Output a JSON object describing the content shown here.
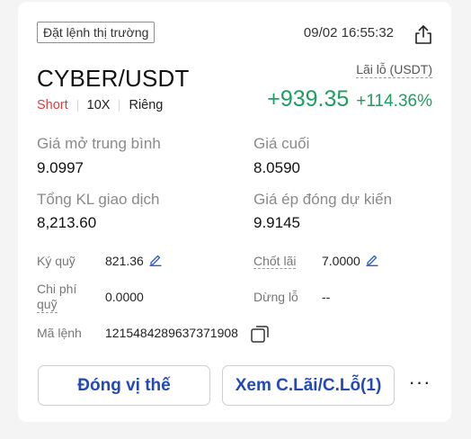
{
  "header": {
    "order_type": "Đặt lệnh thị trường",
    "timestamp": "09/02 16:55:32"
  },
  "position": {
    "pair": "CYBER/USDT",
    "side": "Short",
    "leverage": "10X",
    "margin_mode": "Riêng",
    "pnl_label": "Lãi lỗ (USDT)",
    "pnl_value": "+939.35",
    "pnl_percent": "+114.36%"
  },
  "stats": {
    "avg_open_label": "Giá mở trung bình",
    "avg_open_value": "9.0997",
    "last_price_label": "Giá cuối",
    "last_price_value": "8.0590",
    "total_volume_label": "Tổng KL giao dịch",
    "total_volume_value": "8,213.60",
    "est_liq_label": "Giá ép đóng dự kiến",
    "est_liq_value": "9.9145"
  },
  "details": {
    "margin_label": "Ký quỹ",
    "margin_value": "821.36",
    "take_profit_label": "Chốt lãi",
    "take_profit_value": "7.0000",
    "fee_label_line1": "Chi phí",
    "fee_label_line2": "quỹ",
    "fee_value": "0.0000",
    "stop_loss_label": "Dừng lỗ",
    "stop_loss_value": "--",
    "order_id_label": "Mã lệnh",
    "order_id_value": "1215484289637371908"
  },
  "actions": {
    "close_position": "Đóng vị thế",
    "view_tpsl": "Xem C.Lãi/C.Lỗ(1)",
    "more": "···"
  },
  "colors": {
    "short": "#e23a3a",
    "profit": "#1e9e61",
    "button_text": "#2349b8"
  },
  "icons": {
    "share": "share-icon",
    "edit": "edit-pencil-icon",
    "copy": "copy-icon"
  }
}
